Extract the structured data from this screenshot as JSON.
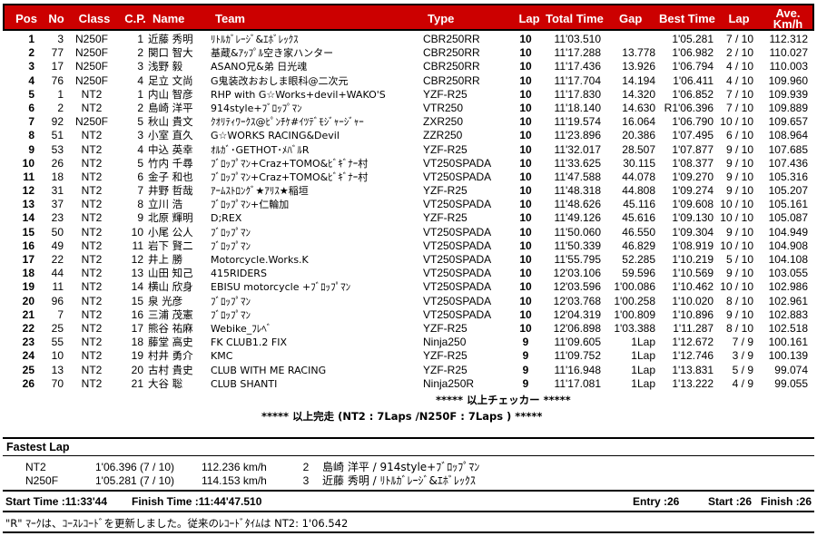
{
  "header": {
    "columns": [
      {
        "key": "pos",
        "label": "Pos"
      },
      {
        "key": "no",
        "label": "No"
      },
      {
        "key": "class",
        "label": "Class"
      },
      {
        "key": "cp",
        "label": "C.P."
      },
      {
        "key": "name",
        "label": "Name"
      },
      {
        "key": "team",
        "label": "Team"
      },
      {
        "key": "type",
        "label": "Type"
      },
      {
        "key": "lap",
        "label": "Lap"
      },
      {
        "key": "total",
        "label": "Total Time"
      },
      {
        "key": "gap",
        "label": "Gap"
      },
      {
        "key": "best",
        "label": "Best Time"
      },
      {
        "key": "lap2",
        "label": "Lap"
      },
      {
        "key": "ave",
        "label": "Ave.\nKm/h"
      },
      {
        "key": "ave1",
        "label": "Ave."
      },
      {
        "key": "ave2",
        "label": "Km/h"
      }
    ],
    "background_color": "#cc0000",
    "text_color": "#ffffff"
  },
  "rows": [
    {
      "pos": "1",
      "no": "3",
      "class": "N250F",
      "cp": "1",
      "name": "近藤 秀明",
      "team": "ﾘﾄﾙｶﾞﾚｰｼﾞ&ｴﾎﾞﾚｯｸｽ",
      "type": "CBR250RR",
      "lap": "10",
      "total": "11'03.510",
      "gap": "",
      "best": "1'05.281",
      "lap2": "7 / 10",
      "ave": "112.312"
    },
    {
      "pos": "2",
      "no": "77",
      "class": "N250F",
      "cp": "2",
      "name": "関口 智大",
      "team": "基蔵&ｱｯﾌﾟﾙ空き家ハンター",
      "type": "CBR250RR",
      "lap": "10",
      "total": "11'17.288",
      "gap": "13.778",
      "best": "1'06.982",
      "lap2": "2 / 10",
      "ave": "110.027"
    },
    {
      "pos": "3",
      "no": "17",
      "class": "N250F",
      "cp": "3",
      "name": "浅野 毅",
      "team": "ASANO兄&弟 日光魂",
      "type": "CBR250RR",
      "lap": "10",
      "total": "11'17.436",
      "gap": "13.926",
      "best": "1'06.794",
      "lap2": "4 / 10",
      "ave": "110.003"
    },
    {
      "pos": "4",
      "no": "76",
      "class": "N250F",
      "cp": "4",
      "name": "足立 文尚",
      "team": "G鬼装改おおしま眼科@二次元",
      "type": "CBR250RR",
      "lap": "10",
      "total": "11'17.704",
      "gap": "14.194",
      "best": "1'06.411",
      "lap2": "4 / 10",
      "ave": "109.960"
    },
    {
      "pos": "5",
      "no": "1",
      "class": "NT2",
      "cp": "1",
      "name": "内山 智彦",
      "team": "RHP with G☆Works+devil+WAKO'S",
      "type": "YZF-R25",
      "lap": "10",
      "total": "11'17.830",
      "gap": "14.320",
      "best": "1'06.852",
      "lap2": "7 / 10",
      "ave": "109.939"
    },
    {
      "pos": "6",
      "no": "2",
      "class": "NT2",
      "cp": "2",
      "name": "島崎 洋平",
      "team": "914style+ﾌﾞﾛｯﾌﾟﾏﾝ",
      "type": "VTR250",
      "lap": "10",
      "total": "11'18.140",
      "gap": "14.630",
      "best": "R1'06.396",
      "lap2": "7 / 10",
      "ave": "109.889"
    },
    {
      "pos": "7",
      "no": "92",
      "class": "N250F",
      "cp": "5",
      "name": "秋山 貴文",
      "team": "ｸｵﾘﾃｨﾜｰｸｽ@ﾋﾟﾝﾁｹ#ｲﾂﾃﾞﾓｼﾞｬｰｼﾞｬｰ",
      "type": "ZXR250",
      "lap": "10",
      "total": "11'19.574",
      "gap": "16.064",
      "best": "1'06.790",
      "lap2": "10 / 10",
      "ave": "109.657"
    },
    {
      "pos": "8",
      "no": "51",
      "class": "NT2",
      "cp": "3",
      "name": "小室 直久",
      "team": "G☆WORKS RACING&Devil",
      "type": "ZZR250",
      "lap": "10",
      "total": "11'23.896",
      "gap": "20.386",
      "best": "1'07.495",
      "lap2": "6 / 10",
      "ave": "108.964"
    },
    {
      "pos": "9",
      "no": "53",
      "class": "NT2",
      "cp": "4",
      "name": "中込 英幸",
      "team": "ｵﾙｶﾞ･GETHOT･ﾒﾊﾞﾙR",
      "type": "YZF-R25",
      "lap": "10",
      "total": "11'32.017",
      "gap": "28.507",
      "best": "1'07.877",
      "lap2": "9 / 10",
      "ave": "107.685"
    },
    {
      "pos": "10",
      "no": "26",
      "class": "NT2",
      "cp": "5",
      "name": "竹内 千尋",
      "team": "ﾌﾞﾛｯﾌﾟﾏﾝ+Craz+TOMO&ﾋﾞｷﾞﾅｰ村",
      "type": "VT250SPADA",
      "lap": "10",
      "total": "11'33.625",
      "gap": "30.115",
      "best": "1'08.377",
      "lap2": "9 / 10",
      "ave": "107.436"
    },
    {
      "pos": "11",
      "no": "18",
      "class": "NT2",
      "cp": "6",
      "name": "金子 和也",
      "team": "ﾌﾞﾛｯﾌﾟﾏﾝ+Craz+TOMO&ﾋﾞｷﾞﾅｰ村",
      "type": "VT250SPADA",
      "lap": "10",
      "total": "11'47.588",
      "gap": "44.078",
      "best": "1'09.270",
      "lap2": "9 / 10",
      "ave": "105.316"
    },
    {
      "pos": "12",
      "no": "31",
      "class": "NT2",
      "cp": "7",
      "name": "井野 哲哉",
      "team": "ｱｰﾑｽﾄﾛﾝｸﾞ★ｱﾘｽ★稲垣",
      "type": "YZF-R25",
      "lap": "10",
      "total": "11'48.318",
      "gap": "44.808",
      "best": "1'09.274",
      "lap2": "9 / 10",
      "ave": "105.207"
    },
    {
      "pos": "13",
      "no": "37",
      "class": "NT2",
      "cp": "8",
      "name": "立川 浩",
      "team": "ﾌﾞﾛｯﾌﾟﾏﾝ+仁輪加",
      "type": "VT250SPADA",
      "lap": "10",
      "total": "11'48.626",
      "gap": "45.116",
      "best": "1'09.608",
      "lap2": "10 / 10",
      "ave": "105.161"
    },
    {
      "pos": "14",
      "no": "23",
      "class": "NT2",
      "cp": "9",
      "name": "北原 輝明",
      "team": "D;REX",
      "type": "YZF-R25",
      "lap": "10",
      "total": "11'49.126",
      "gap": "45.616",
      "best": "1'09.130",
      "lap2": "10 / 10",
      "ave": "105.087"
    },
    {
      "pos": "15",
      "no": "50",
      "class": "NT2",
      "cp": "10",
      "name": "小尾 公人",
      "team": "ﾌﾞﾛｯﾌﾟﾏﾝ",
      "type": "VT250SPADA",
      "lap": "10",
      "total": "11'50.060",
      "gap": "46.550",
      "best": "1'09.304",
      "lap2": "9 / 10",
      "ave": "104.949"
    },
    {
      "pos": "16",
      "no": "49",
      "class": "NT2",
      "cp": "11",
      "name": "岩下 賢二",
      "team": "ﾌﾞﾛｯﾌﾟﾏﾝ",
      "type": "VT250SPADA",
      "lap": "10",
      "total": "11'50.339",
      "gap": "46.829",
      "best": "1'08.919",
      "lap2": "10 / 10",
      "ave": "104.908"
    },
    {
      "pos": "17",
      "no": "22",
      "class": "NT2",
      "cp": "12",
      "name": "井上 勝",
      "team": "Motorcycle.Works.K",
      "type": "VT250SPADA",
      "lap": "10",
      "total": "11'55.795",
      "gap": "52.285",
      "best": "1'10.219",
      "lap2": "5 / 10",
      "ave": "104.108"
    },
    {
      "pos": "18",
      "no": "44",
      "class": "NT2",
      "cp": "13",
      "name": "山田 知己",
      "team": "415RIDERS",
      "type": "VT250SPADA",
      "lap": "10",
      "total": "12'03.106",
      "gap": "59.596",
      "best": "1'10.569",
      "lap2": "9 / 10",
      "ave": "103.055"
    },
    {
      "pos": "19",
      "no": "11",
      "class": "NT2",
      "cp": "14",
      "name": "横山 欣身",
      "team": "EBISU motorcycle +ﾌﾞﾛｯﾌﾟﾏﾝ",
      "type": "VT250SPADA",
      "lap": "10",
      "total": "12'03.596",
      "gap": "1'00.086",
      "best": "1'10.462",
      "lap2": "10 / 10",
      "ave": "102.986"
    },
    {
      "pos": "20",
      "no": "96",
      "class": "NT2",
      "cp": "15",
      "name": "泉 光彦",
      "team": "ﾌﾞﾛｯﾌﾟﾏﾝ",
      "type": "VT250SPADA",
      "lap": "10",
      "total": "12'03.768",
      "gap": "1'00.258",
      "best": "1'10.020",
      "lap2": "8 / 10",
      "ave": "102.961"
    },
    {
      "pos": "21",
      "no": "7",
      "class": "NT2",
      "cp": "16",
      "name": "三浦 茂憲",
      "team": "ﾌﾞﾛｯﾌﾟﾏﾝ",
      "type": "VT250SPADA",
      "lap": "10",
      "total": "12'04.319",
      "gap": "1'00.809",
      "best": "1'10.896",
      "lap2": "9 / 10",
      "ave": "102.883"
    },
    {
      "pos": "22",
      "no": "25",
      "class": "NT2",
      "cp": "17",
      "name": "熊谷 祐麻",
      "team": "Webike_ﾌﾚﾍﾞ",
      "type": "YZF-R25",
      "lap": "10",
      "total": "12'06.898",
      "gap": "1'03.388",
      "best": "1'11.287",
      "lap2": "8 / 10",
      "ave": "102.518"
    },
    {
      "pos": "23",
      "no": "55",
      "class": "NT2",
      "cp": "18",
      "name": "藤堂 高史",
      "team": "FK CLUB1.2 FIX",
      "type": "Ninja250",
      "lap": "9",
      "total": "11'09.605",
      "gap": "1Lap",
      "best": "1'12.672",
      "lap2": "7 / 9",
      "ave": "100.161"
    },
    {
      "pos": "24",
      "no": "10",
      "class": "NT2",
      "cp": "19",
      "name": "村井 勇介",
      "team": "KMC",
      "type": "YZF-R25",
      "lap": "9",
      "total": "11'09.752",
      "gap": "1Lap",
      "best": "1'12.746",
      "lap2": "3 / 9",
      "ave": "100.139"
    },
    {
      "pos": "25",
      "no": "13",
      "class": "NT2",
      "cp": "20",
      "name": "古村 貴史",
      "team": "CLUB WITH ME RACING",
      "type": "YZF-R25",
      "lap": "9",
      "total": "11'16.948",
      "gap": "1Lap",
      "best": "1'13.831",
      "lap2": "5 / 9",
      "ave": "99.074"
    },
    {
      "pos": "26",
      "no": "70",
      "class": "NT2",
      "cp": "21",
      "name": "大谷 聡",
      "team": "CLUB SHANTI",
      "type": "Ninja250R",
      "lap": "9",
      "total": "11'17.081",
      "gap": "1Lap",
      "best": "1'13.222",
      "lap2": "4 / 9",
      "ave": "99.055"
    }
  ],
  "notes": {
    "checker": "***** 以上チェッカー *****",
    "finishers": "***** 以上完走 (NT2 : 7Laps /N250F : 7Laps ) *****"
  },
  "fastest_lap": {
    "title": "Fastest Lap",
    "entries": [
      {
        "class": "NT2",
        "time": "1'06.396 (7 / 10)",
        "speed": "112.236 km/h",
        "pos": "2",
        "who": "島崎 洋平 / 914style+ﾌﾞﾛｯﾌﾟﾏﾝ"
      },
      {
        "class": "N250F",
        "time": "1'05.281 (7 / 10)",
        "speed": "114.153 km/h",
        "pos": "3",
        "who": "近藤 秀明 / ﾘﾄﾙｶﾞﾚｰｼﾞ&ｴﾎﾞﾚｯｸｽ"
      }
    ]
  },
  "summary": {
    "start_time": "Start Time :11:33'44",
    "finish_time": "Finish Time :11:44'47.510",
    "entry": "Entry :26",
    "start": "Start :26",
    "finish": "Finish :26"
  },
  "footnote": "\"R\" ﾏｰｸは、ｺｰｽﾚｺｰﾄﾞを更新しました。従来のﾚｺｰﾄﾞﾀｲﾑは NT2: 1'06.542"
}
